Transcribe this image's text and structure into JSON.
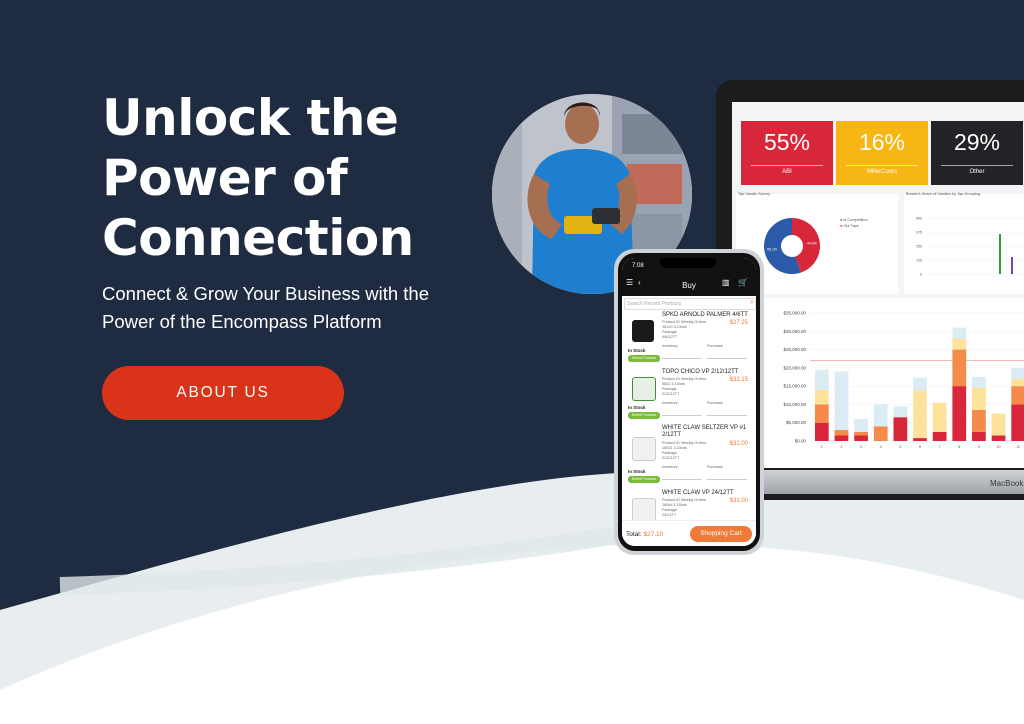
{
  "hero": {
    "headline_lines": [
      "Unlock the",
      "Power of",
      "Connection"
    ],
    "subhead_lines": [
      "Connect & Grow Your Business with the",
      "Power of the Encompass Platform"
    ],
    "cta_label": "ABOUT US"
  },
  "colors": {
    "navy": "#1f2b40",
    "cta": "#d9341a",
    "accent_orange": "#f07a3a",
    "tile_red": "#d9273a",
    "tile_yellow": "#f7b613",
    "tile_dark": "#222326"
  },
  "laptop": {
    "brand_label": "MacBook",
    "tiles": [
      {
        "value": "55%",
        "label": "ABI"
      },
      {
        "value": "16%",
        "label": "MillerCoors"
      },
      {
        "value": "29%",
        "label": "Other"
      }
    ],
    "donut_panel_title": "Tap Handle Survey",
    "donut_legend": [
      "Is Competition",
      "Our Taps"
    ],
    "donut_labels": [
      "44.9%",
      "55.1%"
    ],
    "share_panel_title": "Brewer's Share of Handles by Tap Grouping",
    "chart_data": [
      {
        "type": "pie",
        "title": "Tap Handle Survey",
        "categories": [
          "Is Competition",
          "Our Taps"
        ],
        "values": [
          44.9,
          55.1
        ]
      },
      {
        "type": "bar",
        "ylim": [
          0,
          35000
        ],
        "yticks": [
          "$35,000.00",
          "$30,000.00",
          "$25,000.00",
          "$20,000.00",
          "$15,000.00",
          "$10,000.00",
          "$5,000.00",
          "$0.00"
        ],
        "categories": [
          "1",
          "2",
          "3",
          "4",
          "5",
          "6",
          "7",
          "8",
          "9",
          "10",
          "11"
        ],
        "series": [
          {
            "values": [
              5000,
              1500,
              1500,
              0,
              6500,
              800,
              2500,
              15000,
              2500,
              1500,
              10000
            ]
          },
          {
            "values": [
              5000,
              1500,
              1000,
              4000,
              0,
              0,
              0,
              10000,
              6000,
              0,
              5000
            ]
          },
          {
            "values": [
              4000,
              0,
              0,
              0,
              0,
              13000,
              8000,
              3000,
              6000,
              6000,
              2000
            ]
          },
          {
            "values": [
              5500,
              16000,
              3500,
              6000,
              3000,
              3500,
              0,
              3000,
              3000,
              0,
              3000
            ]
          }
        ]
      }
    ],
    "bar_colors": [
      "#d9273a",
      "#f58a4b",
      "#fde29c",
      "#dbecf5",
      "#2b5aa8"
    ],
    "x_tick_labels": [
      "1",
      "2",
      "3",
      "4",
      "5",
      "6",
      "7",
      "8",
      "9",
      "10",
      "11"
    ]
  },
  "phone": {
    "status_time": "7:08",
    "screen_title": "Buy",
    "search_placeholder": "Search Recent Products",
    "products": [
      {
        "name": "SPKD ARNOLD PALMER 4/6TT",
        "price": "$27.25",
        "meta1": "Product ID  Weekly Orders",
        "meta2": "16120        3.13/wk",
        "meta3": "Package",
        "meta4": "4/6/12TT",
        "stock": "In Stock",
        "pill": "Select Products",
        "f1": "Inventory",
        "f2": "Purchase"
      },
      {
        "name": "TOPO CHICO VP 2/12/12TT",
        "price": "$32.15",
        "meta1": "Product ID  Weekly Orders",
        "meta2": "9822        4.13/wk",
        "meta3": "Package",
        "meta4": "2/12/12TT",
        "stock": "In Stock",
        "pill": "Select Products",
        "f1": "Inventory",
        "f2": "Purchase"
      },
      {
        "name": "WHITE CLAW SELTZER VP #1 2/12TT",
        "price": "$31.00",
        "meta1": "Product ID  Weekly Orders",
        "meta2": "16921        0.23/wk",
        "meta3": "Package",
        "meta4": "2/12/12TT",
        "stock": "In Stock",
        "pill": "Select Products",
        "f1": "Inventory",
        "f2": "Purchase"
      },
      {
        "name": "WHITE CLAW VP 24/12TT",
        "price": "$31.00",
        "meta1": "Product ID  Weekly Orders",
        "meta2": "16944        1.15/wk",
        "meta3": "Package",
        "meta4": "24/12TT",
        "stock": "",
        "pill": "",
        "f1": "",
        "f2": ""
      }
    ],
    "total_label": "Total:",
    "total_value": "$27.10",
    "cart_label": "Shopping Cart"
  }
}
